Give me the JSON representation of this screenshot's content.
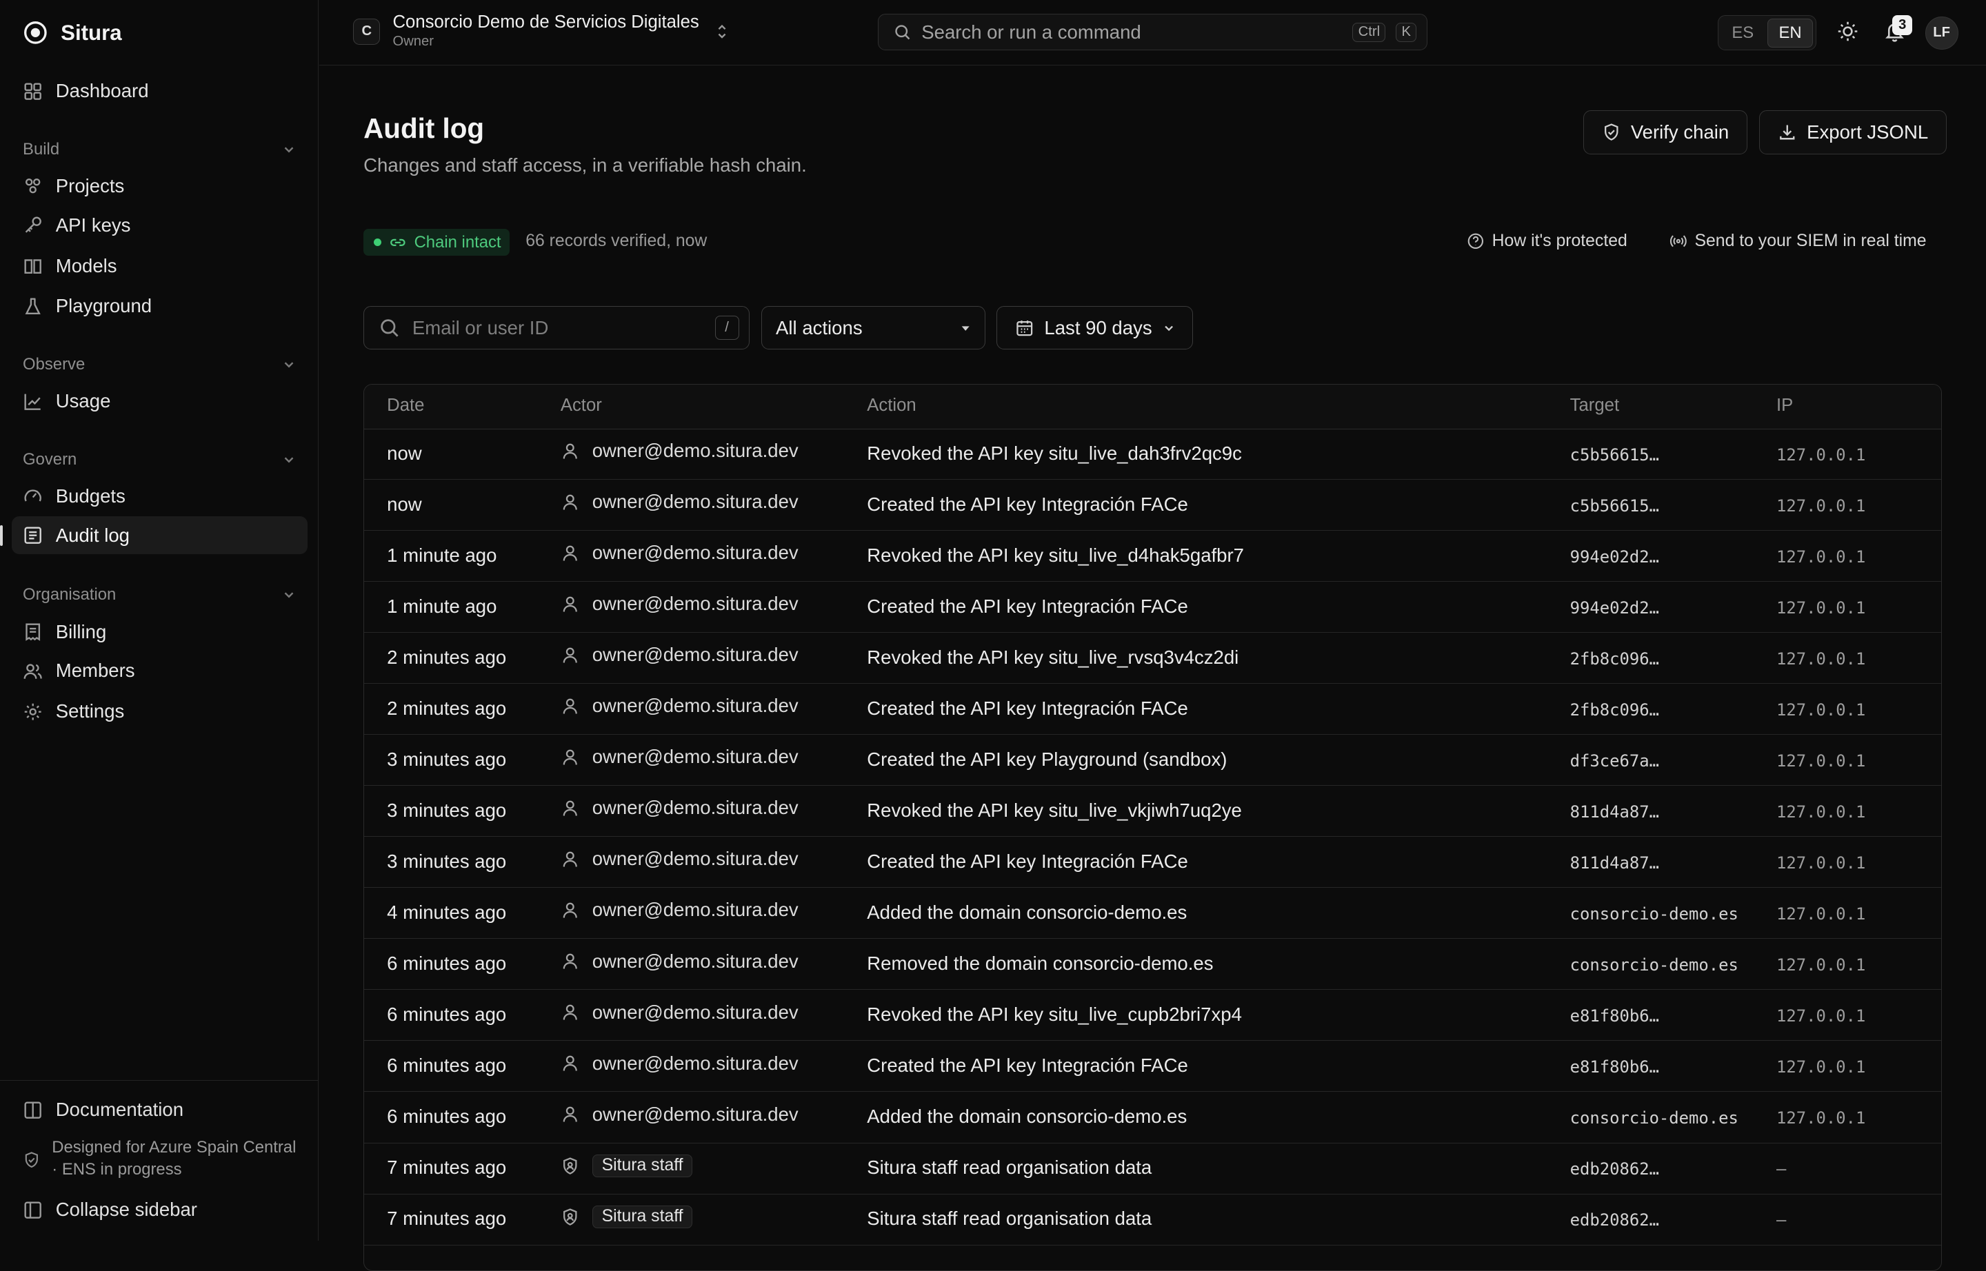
{
  "brand": {
    "name": "Situra"
  },
  "sidebar": {
    "dashboard": "Dashboard",
    "groups": {
      "build": "Build",
      "observe": "Observe",
      "govern": "Govern",
      "organisation": "Organisation"
    },
    "items": {
      "projects": "Projects",
      "api_keys": "API keys",
      "models": "Models",
      "playground": "Playground",
      "usage": "Usage",
      "budgets": "Budgets",
      "audit_log": "Audit log",
      "billing": "Billing",
      "members": "Members",
      "settings": "Settings"
    },
    "footer": {
      "documentation": "Documentation",
      "note": "Designed for Azure Spain Central · ENS in progress",
      "collapse": "Collapse sidebar"
    }
  },
  "topbar": {
    "org_initial": "C",
    "org_name": "Consorcio Demo de Servicios Digitales",
    "org_role": "Owner",
    "search_placeholder": "Search or run a command",
    "search_kbd_1": "Ctrl",
    "search_kbd_2": "K",
    "lang_es": "ES",
    "lang_en": "EN",
    "notifications_count": "3",
    "avatar_initials": "LF"
  },
  "page": {
    "title": "Audit log",
    "subtitle": "Changes and staff access, in a verifiable hash chain.",
    "verify_button": "Verify chain",
    "export_button": "Export JSONL",
    "chain_status": "Chain intact",
    "chain_meta": "66 records verified, now",
    "how_protected": "How it's protected",
    "siem_link": "Send to your SIEM in real time"
  },
  "filters": {
    "search_placeholder": "Email or user ID",
    "search_shortcut": "/",
    "action_select": "All actions",
    "date_range": "Last 90 days"
  },
  "table": {
    "headers": {
      "date": "Date",
      "actor": "Actor",
      "action": "Action",
      "target": "Target",
      "ip": "IP"
    },
    "rows": [
      {
        "date": "now",
        "actor": "owner@demo.situra.dev",
        "actor_type": "user",
        "action": "Revoked the API key situ_live_dah3frv2qc9c",
        "target": "c5b56615…",
        "ip": "127.0.0.1"
      },
      {
        "date": "now",
        "actor": "owner@demo.situra.dev",
        "actor_type": "user",
        "action": "Created the API key Integración FACe",
        "target": "c5b56615…",
        "ip": "127.0.0.1"
      },
      {
        "date": "1 minute ago",
        "actor": "owner@demo.situra.dev",
        "actor_type": "user",
        "action": "Revoked the API key situ_live_d4hak5gafbr7",
        "target": "994e02d2…",
        "ip": "127.0.0.1"
      },
      {
        "date": "1 minute ago",
        "actor": "owner@demo.situra.dev",
        "actor_type": "user",
        "action": "Created the API key Integración FACe",
        "target": "994e02d2…",
        "ip": "127.0.0.1"
      },
      {
        "date": "2 minutes ago",
        "actor": "owner@demo.situra.dev",
        "actor_type": "user",
        "action": "Revoked the API key situ_live_rvsq3v4cz2di",
        "target": "2fb8c096…",
        "ip": "127.0.0.1"
      },
      {
        "date": "2 minutes ago",
        "actor": "owner@demo.situra.dev",
        "actor_type": "user",
        "action": "Created the API key Integración FACe",
        "target": "2fb8c096…",
        "ip": "127.0.0.1"
      },
      {
        "date": "3 minutes ago",
        "actor": "owner@demo.situra.dev",
        "actor_type": "user",
        "action": "Created the API key Playground (sandbox)",
        "target": "df3ce67a…",
        "ip": "127.0.0.1"
      },
      {
        "date": "3 minutes ago",
        "actor": "owner@demo.situra.dev",
        "actor_type": "user",
        "action": "Revoked the API key situ_live_vkjiwh7uq2ye",
        "target": "811d4a87…",
        "ip": "127.0.0.1"
      },
      {
        "date": "3 minutes ago",
        "actor": "owner@demo.situra.dev",
        "actor_type": "user",
        "action": "Created the API key Integración FACe",
        "target": "811d4a87…",
        "ip": "127.0.0.1"
      },
      {
        "date": "4 minutes ago",
        "actor": "owner@demo.situra.dev",
        "actor_type": "user",
        "action": "Added the domain consorcio-demo.es",
        "target": "consorcio-demo.es",
        "ip": "127.0.0.1"
      },
      {
        "date": "6 minutes ago",
        "actor": "owner@demo.situra.dev",
        "actor_type": "user",
        "action": "Removed the domain consorcio-demo.es",
        "target": "consorcio-demo.es",
        "ip": "127.0.0.1"
      },
      {
        "date": "6 minutes ago",
        "actor": "owner@demo.situra.dev",
        "actor_type": "user",
        "action": "Revoked the API key situ_live_cupb2bri7xp4",
        "target": "e81f80b6…",
        "ip": "127.0.0.1"
      },
      {
        "date": "6 minutes ago",
        "actor": "owner@demo.situra.dev",
        "actor_type": "user",
        "action": "Created the API key Integración FACe",
        "target": "e81f80b6…",
        "ip": "127.0.0.1"
      },
      {
        "date": "6 minutes ago",
        "actor": "owner@demo.situra.dev",
        "actor_type": "user",
        "action": "Added the domain consorcio-demo.es",
        "target": "consorcio-demo.es",
        "ip": "127.0.0.1"
      },
      {
        "date": "7 minutes ago",
        "actor": "Situra staff",
        "actor_type": "staff",
        "action": "Situra staff read organisation data",
        "target": "edb20862…",
        "ip": "–"
      },
      {
        "date": "7 minutes ago",
        "actor": "Situra staff",
        "actor_type": "staff",
        "action": "Situra staff read organisation data",
        "target": "edb20862…",
        "ip": "–"
      }
    ]
  },
  "colors": {
    "background": "#0b0b0b",
    "chain_ok": "#3ecf74",
    "border": "#2b2b2b"
  }
}
